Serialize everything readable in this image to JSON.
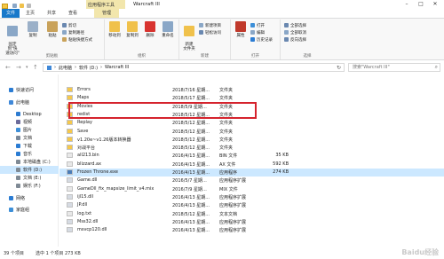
{
  "window": {
    "title": "Warcraft III",
    "context_tab": "应用程序工具"
  },
  "tabs": [
    {
      "label": "文件"
    },
    {
      "label": "主页"
    },
    {
      "label": "共享"
    },
    {
      "label": "查看"
    },
    {
      "label": "管理"
    }
  ],
  "ribbon": {
    "clipboard": {
      "pin": "固定到\"快\n速访问\"",
      "copy": "复制",
      "paste": "粘贴",
      "cut": "剪切",
      "copy_path": "复制路径",
      "paste_shortcut": "粘贴快捷方式",
      "group": "剪贴板"
    },
    "organize": {
      "move_to": "移动到",
      "copy_to": "复制到",
      "delete": "删除",
      "rename": "重命名",
      "group": "组织"
    },
    "new": {
      "new_folder": "新建\n文件夹",
      "new_item": "新建项目",
      "easy_access": "轻松访问",
      "group": "新建"
    },
    "open": {
      "properties": "属性",
      "open": "打开",
      "edit": "编辑",
      "history": "历史记录",
      "group": "打开"
    },
    "select": {
      "select_all": "全部选择",
      "select_none": "全部取消",
      "invert": "反向选择",
      "group": "选择"
    }
  },
  "address": {
    "crumbs": [
      "此电脑",
      "软件 (D:)",
      "Warcraft III"
    ],
    "search_placeholder": "搜索\"Warcraft III\""
  },
  "nav": [
    {
      "label": "快速访问",
      "icon": "star-icon",
      "color": "#2b7cd3",
      "indent": 0
    },
    {
      "label": "此电脑",
      "icon": "computer-icon",
      "color": "#3f88d8",
      "indent": 0
    },
    {
      "label": "Desktop",
      "icon": "desktop-icon",
      "color": "#2e7bd0",
      "indent": 1
    },
    {
      "label": "视频",
      "icon": "video-icon",
      "color": "#6b6b9a",
      "indent": 1
    },
    {
      "label": "图片",
      "icon": "image-icon",
      "color": "#3d8fd8",
      "indent": 1
    },
    {
      "label": "文档",
      "icon": "document-icon",
      "color": "#7a8899",
      "indent": 1
    },
    {
      "label": "下载",
      "icon": "download-icon",
      "color": "#2b7cd3",
      "indent": 1
    },
    {
      "label": "音乐",
      "icon": "music-icon",
      "color": "#2b7cd3",
      "indent": 1
    },
    {
      "label": "本地磁盘 (C:)",
      "icon": "drive-icon",
      "color": "#7f8a95",
      "indent": 1
    },
    {
      "label": "软件 (D:)",
      "icon": "drive-icon",
      "color": "#7f8a95",
      "indent": 1,
      "selected": true
    },
    {
      "label": "文档 (E:)",
      "icon": "drive-icon",
      "color": "#7f8a95",
      "indent": 1
    },
    {
      "label": "娱乐 (F:)",
      "icon": "drive-icon",
      "color": "#7f8a95",
      "indent": 1
    },
    {
      "label": "网络",
      "icon": "network-icon",
      "color": "#2b7cd3",
      "indent": 0
    },
    {
      "label": "家庭组",
      "icon": "homegroup-icon",
      "color": "#3d8fd8",
      "indent": 0
    }
  ],
  "files": [
    {
      "name": "Errors",
      "date": "2018/7/16 星期...",
      "type": "文件夹",
      "size": "",
      "kind": "folder"
    },
    {
      "name": "Maps",
      "date": "2018/5/17 星期...",
      "type": "文件夹",
      "size": "",
      "kind": "folder"
    },
    {
      "name": "Movies",
      "date": "2018/5/9 星期...",
      "type": "文件夹",
      "size": "",
      "kind": "folder"
    },
    {
      "name": "redist",
      "date": "2018/5/12 星期...",
      "type": "文件夹",
      "size": "",
      "kind": "folder"
    },
    {
      "name": "Replay",
      "date": "2018/5/12 星期...",
      "type": "文件夹",
      "size": "",
      "kind": "folder"
    },
    {
      "name": "Save",
      "date": "2018/5/12 星期...",
      "type": "文件夹",
      "size": "",
      "kind": "folder"
    },
    {
      "name": "v1.20e~v1.26版本转换器",
      "date": "2018/5/12 星期...",
      "type": "文件夹",
      "size": "",
      "kind": "folder"
    },
    {
      "name": "对战平台",
      "date": "2018/5/12 星期...",
      "type": "文件夹",
      "size": "",
      "kind": "folder"
    },
    {
      "name": "all213.bin",
      "date": "2016/4/13 星期...",
      "type": "BIN 文件",
      "size": "35 KB",
      "kind": "file"
    },
    {
      "name": "blizzard.ax",
      "date": "2016/4/13 星期...",
      "type": "AX 文件",
      "size": "592 KB",
      "kind": "file"
    },
    {
      "name": "Frozen Throne.exe",
      "date": "2016/4/13 星期...",
      "type": "应用程序",
      "size": "274 KB",
      "kind": "exe",
      "selected": true
    },
    {
      "name": "Game.dll",
      "date": "2016/5/7 星期...",
      "type": "应用程序扩展",
      "size": "",
      "kind": "dll"
    },
    {
      "name": "GameDll_fix_mapsize_limit_v4.mix",
      "date": "2016/7/9 星期...",
      "type": "MIX 文件",
      "size": "",
      "kind": "file"
    },
    {
      "name": "ijl15.dll",
      "date": "2016/4/13 星期...",
      "type": "应用程序扩展",
      "size": "",
      "kind": "dll"
    },
    {
      "name": "JP.dll",
      "date": "2016/4/13 星期...",
      "type": "应用程序扩展",
      "size": "",
      "kind": "dll"
    },
    {
      "name": "log.txt",
      "date": "2018/5/12 星期...",
      "type": "文本文档",
      "size": "",
      "kind": "file"
    },
    {
      "name": "Mss32.dll",
      "date": "2016/4/13 星期...",
      "type": "应用程序扩展",
      "size": "",
      "kind": "dll"
    },
    {
      "name": "msvcp120.dll",
      "date": "2016/4/13 星期...",
      "type": "应用程序扩展",
      "size": "",
      "kind": "dll"
    }
  ],
  "status": {
    "count": "39 个项目",
    "selected": "选中 1 个项目 273 KB"
  },
  "watermark": "Baidu经验"
}
